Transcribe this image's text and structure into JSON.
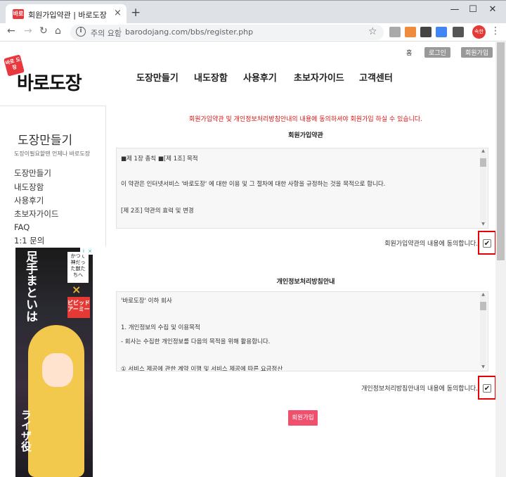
{
  "browser": {
    "tab_title": "회원가입약관 | 바로도장",
    "tab_close": "×",
    "new_tab": "+",
    "favicon_text": "바로",
    "security_label": "주의 요함",
    "url": "barodojang.com/bbs/register.php",
    "profile_label": "속한"
  },
  "util": {
    "home": "홈",
    "login": "로그인",
    "join": "회원가입"
  },
  "logo": {
    "badge": "바로 도장",
    "text": "바로도장"
  },
  "gnb": [
    "도장만들기",
    "내도장함",
    "사용후기",
    "초보자가이드",
    "고객센터"
  ],
  "sidebar": {
    "title": "도장만들기",
    "subtitle": "도장이필요할땐 언제나 바로도장",
    "items": [
      "도장만들기",
      "내도장함",
      "사용후기",
      "초보자가이드",
      "FAQ",
      "1:1 문의"
    ]
  },
  "ad": {
    "text1": "足手まといは",
    "text2": "かつて神だった獣たちへ",
    "x": "×",
    "logo": "ビビッドアーミー",
    "bottom": "ライザ役"
  },
  "notice": "회원가입약관 및 개인정보처리방침안내의 내용에 동의하셔야 회원가입 하실 수 있습니다.",
  "terms": {
    "title": "회원가입약관",
    "lines": [
      "■제 1장 총칙 ■[제 1조] 목적",
      "이 약관은 인터넷서비스 '바로도장' 에 대한 이용 및 그 절차에 대한 사항을 규정하는 것을 목적으로 합니다.",
      "[제 2조] 약관의 효력 및 변경"
    ],
    "agree_label": "회원가입약관의 내용에 동의합니다."
  },
  "privacy": {
    "title": "개인정보처리방침안내",
    "lines": [
      "'바로도장' 이하 회사",
      "1. 개인정보의 수집 및 이용목적",
      "- 회사는 수집한 개인정보를 다음의 목적을 위해 활용합니다.",
      "① 서비스 제공에 관한 계약 이행 및 서비스 제공에 따른 요금정산"
    ],
    "agree_label": "개인정보처리방침안내의 내용에 동의합니다."
  },
  "submit_label": "회원가입",
  "colors": {
    "accent": "#f0506e",
    "notice": "#dd1111",
    "highlight": "#ee0000"
  }
}
